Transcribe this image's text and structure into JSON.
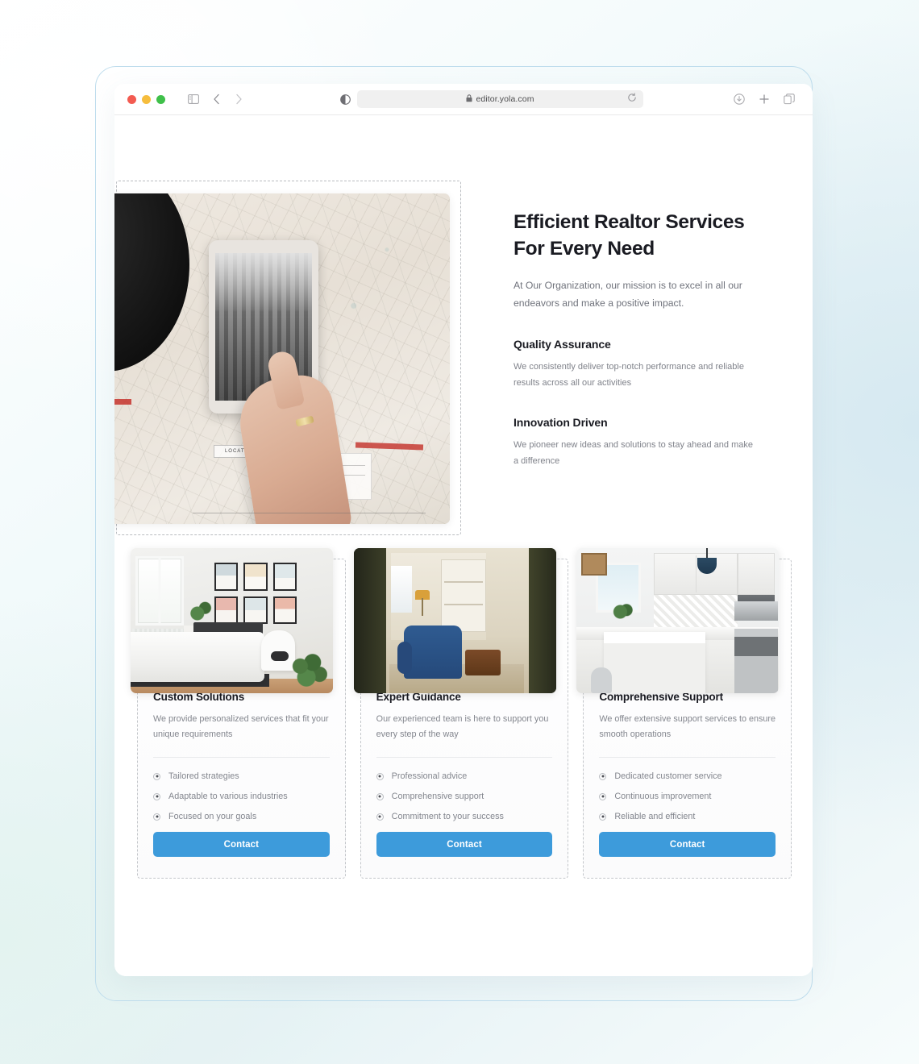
{
  "browser": {
    "url": "editor.yola.com",
    "lock_icon": "lock-icon",
    "reload_icon": "reload-icon",
    "reader_icon": "reader-mode-icon",
    "sidebar_icon": "sidebar-toggle-icon",
    "back_icon": "back-arrow-icon",
    "forward_icon": "forward-arrow-icon",
    "download_icon": "download-icon",
    "new_tab_icon": "plus-icon",
    "tabs_icon": "tab-overview-icon",
    "traffic_lights": [
      "close-button",
      "minimize-button",
      "maximize-button"
    ]
  },
  "hero": {
    "heading": "Efficient Realtor Services For Every Need",
    "subheading": "At Our Organization, our mission is to excel in all our endeavors and make a positive impact.",
    "image_alt": "tablet-on-map-photo",
    "features": [
      {
        "title": "Quality Assurance",
        "body": "We consistently deliver top-notch performance and reliable results across all our activities"
      },
      {
        "title": "Innovation Driven",
        "body": "We pioneer new ideas and solutions to stay ahead and make a difference"
      }
    ]
  },
  "cards": [
    {
      "image_alt": "bedroom-interior-photo",
      "title": "Custom Solutions",
      "desc": "We provide personalized services that fit your unique requirements",
      "list": [
        "Tailored strategies",
        "Adaptable to various industries",
        "Focused on your goals"
      ],
      "button": "Contact"
    },
    {
      "image_alt": "living-room-doorway-photo",
      "title": "Expert Guidance",
      "desc": "Our experienced team is here to support you every step of the way",
      "list": [
        "Professional advice",
        "Comprehensive support",
        "Commitment to your success"
      ],
      "button": "Contact"
    },
    {
      "image_alt": "kitchen-interior-photo",
      "title": "Comprehensive Support",
      "desc": "We offer extensive support services to ensure smooth operations",
      "list": [
        "Dedicated customer service",
        "Continuous improvement",
        "Reliable and efficient"
      ],
      "button": "Contact"
    }
  ],
  "colors": {
    "accent_blue": "#3d9bdb",
    "heading": "#1a1b22",
    "body_text": "#83868e",
    "frame_border": "#bfdded",
    "dashed_border": "#c3c6ca"
  }
}
